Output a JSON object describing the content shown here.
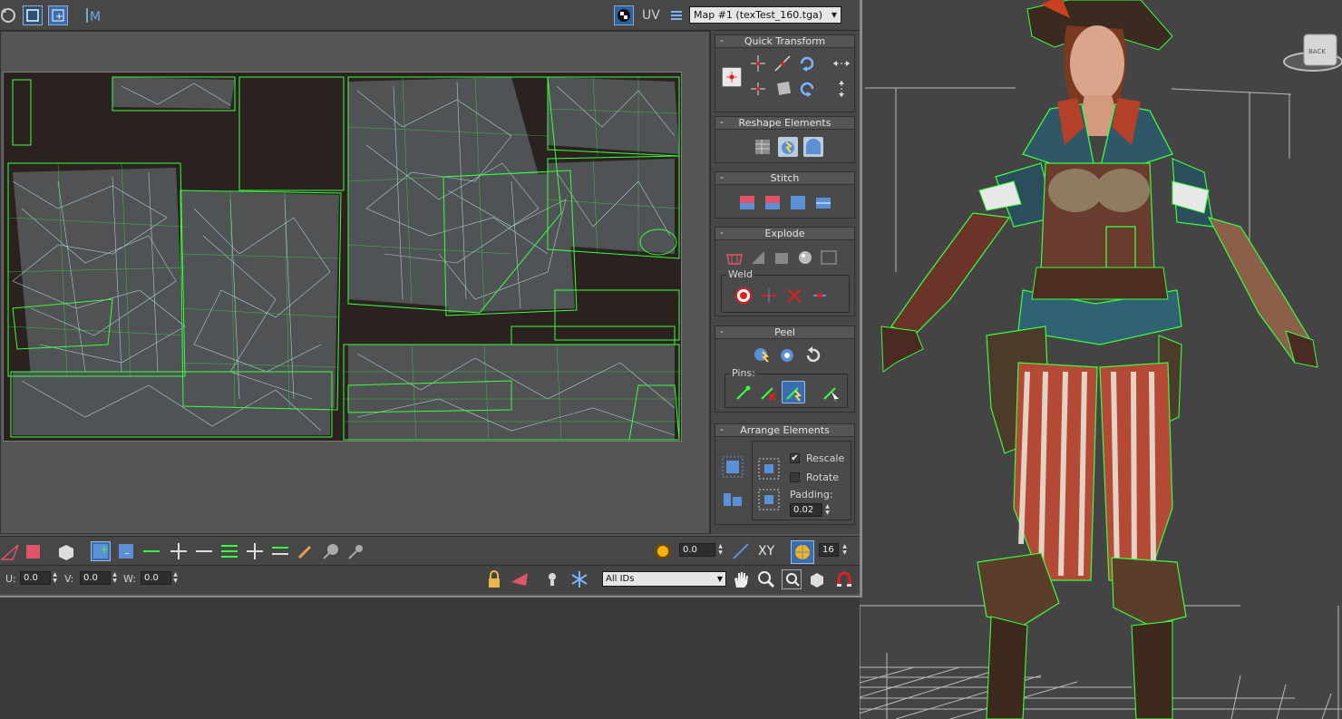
{
  "toolbar": {
    "uv_label": "UV",
    "map_select": "Map #1 (texTest_160.tga)"
  },
  "panel": {
    "quick_transform": "Quick Transform",
    "reshape_elements": "Reshape Elements",
    "stitch": "Stitch",
    "explode": "Explode",
    "weld": "Weld",
    "peel": "Peel",
    "pins": "Pins:",
    "arrange_elements": "Arrange Elements",
    "rescale": "Rescale",
    "rescale_checked": true,
    "rotate": "Rotate",
    "rotate_checked": false,
    "padding_label": "Padding:",
    "padding_value": "0.02",
    "collapse_symbol": "-"
  },
  "bottom": {
    "u_label": "U:",
    "u_value": "0.0",
    "v_label": "V:",
    "v_value": "0.0",
    "w_label": "W:",
    "w_value": "0.0",
    "ids_select": "All IDs",
    "soft_value": "0.0",
    "xy_label": "XY",
    "grid_value": "16"
  },
  "viewcube": {
    "label": "BACK"
  },
  "colors": {
    "wire_green": "#39ff3f",
    "wire_cyan": "#bff7ff",
    "panel_bg": "#474747",
    "viewport_bg": "#444444"
  }
}
